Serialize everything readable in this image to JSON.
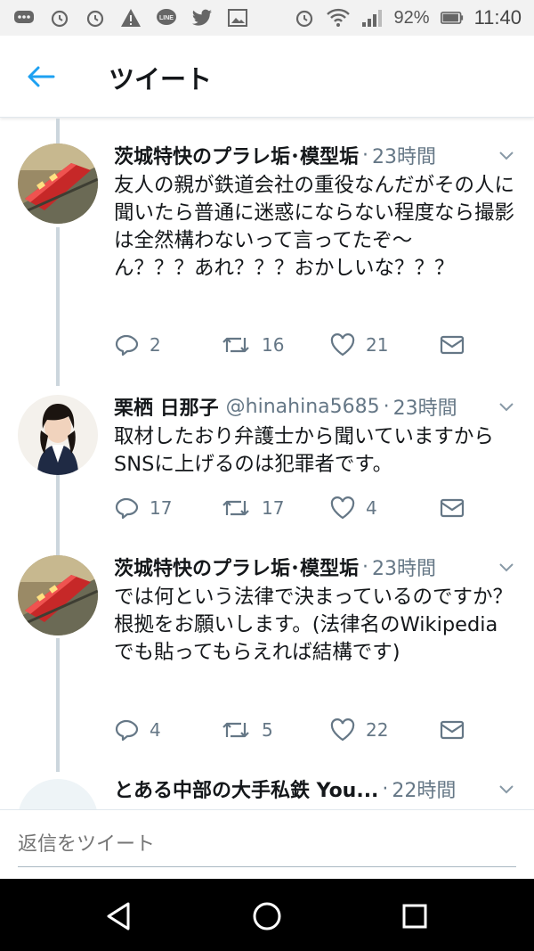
{
  "status_bar": {
    "battery_percent": "92%",
    "time": "11:40",
    "icons": [
      "message-icon",
      "alarm-icon",
      "alarm-icon",
      "warning-icon",
      "line-icon",
      "twitter-icon",
      "image-icon",
      "alarm-icon",
      "wifi-icon",
      "signal-icon",
      "battery-icon"
    ]
  },
  "header": {
    "back_icon": "arrow-left-icon",
    "title": "ツイート"
  },
  "tweets": [
    {
      "name": "茨城特快のプラレ垢･模型垢",
      "handle": "",
      "time": "23時間",
      "body": "友人の親が鉄道会社の重役なんだがその人に聞いたら普通に迷惑にならない程度なら撮影は全然構わないって言ってたぞ〜\nん？？？あれ？？？おかしいな？？？",
      "reply_count": "2",
      "retweet_count": "16",
      "like_count": "21"
    },
    {
      "name": "栗栖 日那子",
      "handle": "@hinahina5685",
      "time": "23時間",
      "body": "取材したおり弁護士から聞いていますからSNSに上げるのは犯罪者です。",
      "reply_count": "17",
      "retweet_count": "17",
      "like_count": "4"
    },
    {
      "name": "茨城特快のプラレ垢･模型垢",
      "handle": "",
      "time": "23時間",
      "body": "では何という法律で決まっているのですか？根拠をお願いします。(法律名のWikipediaでも貼ってもらえれば結構です)",
      "reply_count": "4",
      "retweet_count": "5",
      "like_count": "22"
    },
    {
      "name": "とある中部の大手私鉄 You...",
      "handle": "",
      "time": "22時間",
      "body": "",
      "reply_count": "",
      "retweet_count": "",
      "like_count": ""
    }
  ],
  "reply_bar": {
    "placeholder": "返信をツイート"
  },
  "nav": {
    "icons": [
      "back-triangle-icon",
      "home-circle-icon",
      "recents-square-icon"
    ]
  },
  "colors": {
    "accent": "#1da1f2",
    "secondary_text": "#657786",
    "thread_line": "#ccd6dd"
  }
}
